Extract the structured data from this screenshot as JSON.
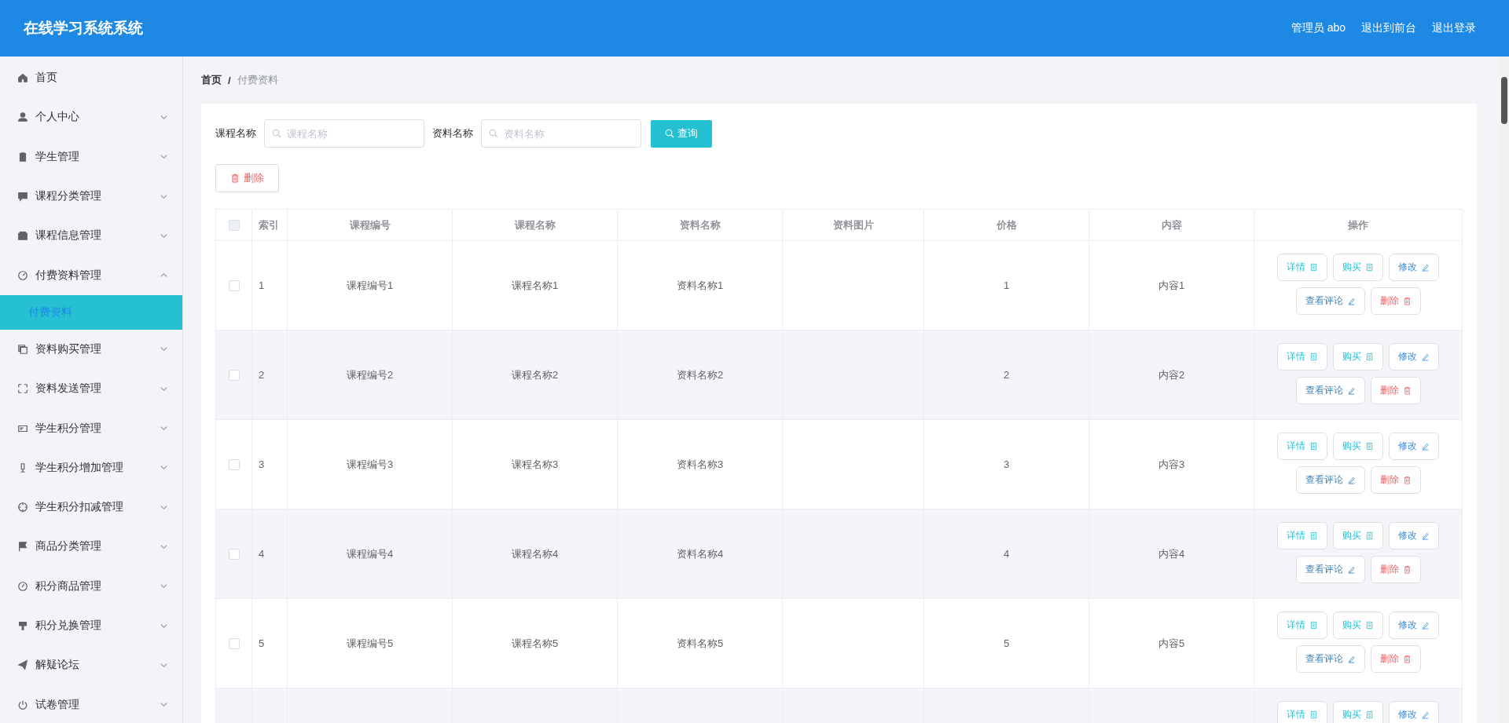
{
  "header": {
    "title": "在线学习系统系统",
    "links": [
      "管理员 abo",
      "退出到前台",
      "退出登录"
    ]
  },
  "sidebar": {
    "items": [
      {
        "label": "首页",
        "kind": "link"
      },
      {
        "label": "个人中心",
        "kind": "menu",
        "expanded": false
      },
      {
        "label": "学生管理",
        "kind": "menu",
        "expanded": false
      },
      {
        "label": "课程分类管理",
        "kind": "menu",
        "expanded": false
      },
      {
        "label": "课程信息管理",
        "kind": "menu",
        "expanded": false
      },
      {
        "label": "付费资料管理",
        "kind": "menu",
        "expanded": true,
        "children": [
          {
            "label": "付费资料",
            "selected": true
          }
        ]
      },
      {
        "label": "资料购买管理",
        "kind": "menu",
        "expanded": false
      },
      {
        "label": "资料发送管理",
        "kind": "menu",
        "expanded": false
      },
      {
        "label": "学生积分管理",
        "kind": "menu",
        "expanded": false
      },
      {
        "label": "学生积分增加管理",
        "kind": "menu",
        "expanded": false
      },
      {
        "label": "学生积分扣减管理",
        "kind": "menu",
        "expanded": false
      },
      {
        "label": "商品分类管理",
        "kind": "menu",
        "expanded": false
      },
      {
        "label": "积分商品管理",
        "kind": "menu",
        "expanded": false
      },
      {
        "label": "积分兑换管理",
        "kind": "menu",
        "expanded": false
      },
      {
        "label": "解疑论坛",
        "kind": "menu",
        "expanded": false
      },
      {
        "label": "试卷管理",
        "kind": "menu",
        "expanded": false
      }
    ]
  },
  "breadcrumb": {
    "items": [
      "首页",
      "付费资料"
    ],
    "separator": "/"
  },
  "search": {
    "fields": [
      {
        "label": "课程名称",
        "placeholder": "课程名称"
      },
      {
        "label": "资料名称",
        "placeholder": "资料名称"
      }
    ],
    "button": "查询"
  },
  "delete_button": "删除",
  "table": {
    "select_all_checked": false,
    "columns": [
      "索引",
      "课程编号",
      "课程名称",
      "资料名称",
      "资料图片",
      "价格",
      "内容",
      "操作"
    ],
    "rows": [
      {
        "checked": false,
        "cells": [
          "1",
          "课程编号1",
          "课程名称1",
          "资料名称1",
          "1",
          "内容1"
        ],
        "actions": [
          {
            "label": "详情",
            "kind": "detail"
          },
          {
            "label": "购买",
            "kind": "buy"
          },
          {
            "label": "修改",
            "kind": "edit"
          },
          {
            "label": "查看评论",
            "kind": "comment"
          },
          {
            "label": "删除",
            "kind": "delete"
          }
        ]
      },
      {
        "checked": false,
        "cells": [
          "2",
          "课程编号2",
          "课程名称2",
          "资料名称2",
          "2",
          "内容2"
        ],
        "actions": [
          {
            "label": "详情",
            "kind": "detail"
          },
          {
            "label": "购买",
            "kind": "buy"
          },
          {
            "label": "修改",
            "kind": "edit"
          },
          {
            "label": "查看评论",
            "kind": "comment"
          },
          {
            "label": "删除",
            "kind": "delete"
          }
        ]
      },
      {
        "checked": false,
        "cells": [
          "3",
          "课程编号3",
          "课程名称3",
          "资料名称3",
          "3",
          "内容3"
        ],
        "actions": [
          {
            "label": "详情",
            "kind": "detail"
          },
          {
            "label": "购买",
            "kind": "buy"
          },
          {
            "label": "修改",
            "kind": "edit"
          },
          {
            "label": "查看评论",
            "kind": "comment"
          },
          {
            "label": "删除",
            "kind": "delete"
          }
        ]
      },
      {
        "checked": false,
        "cells": [
          "4",
          "课程编号4",
          "课程名称4",
          "资料名称4",
          "4",
          "内容4"
        ],
        "actions": [
          {
            "label": "详情",
            "kind": "detail"
          },
          {
            "label": "购买",
            "kind": "buy"
          },
          {
            "label": "修改",
            "kind": "edit"
          },
          {
            "label": "查看评论",
            "kind": "comment"
          },
          {
            "label": "删除",
            "kind": "delete"
          }
        ]
      },
      {
        "checked": false,
        "cells": [
          "5",
          "课程编号5",
          "课程名称5",
          "资料名称5",
          "5",
          "内容5"
        ],
        "actions": [
          {
            "label": "详情",
            "kind": "detail"
          },
          {
            "label": "购买",
            "kind": "buy"
          },
          {
            "label": "修改",
            "kind": "edit"
          },
          {
            "label": "查看评论",
            "kind": "comment"
          },
          {
            "label": "删除",
            "kind": "delete"
          }
        ]
      },
      {
        "actions": [
          {
            "label": "详情",
            "kind": "detail"
          },
          {
            "label": "购买",
            "kind": "buy"
          },
          {
            "label": "修改",
            "kind": "edit"
          }
        ]
      }
    ]
  }
}
